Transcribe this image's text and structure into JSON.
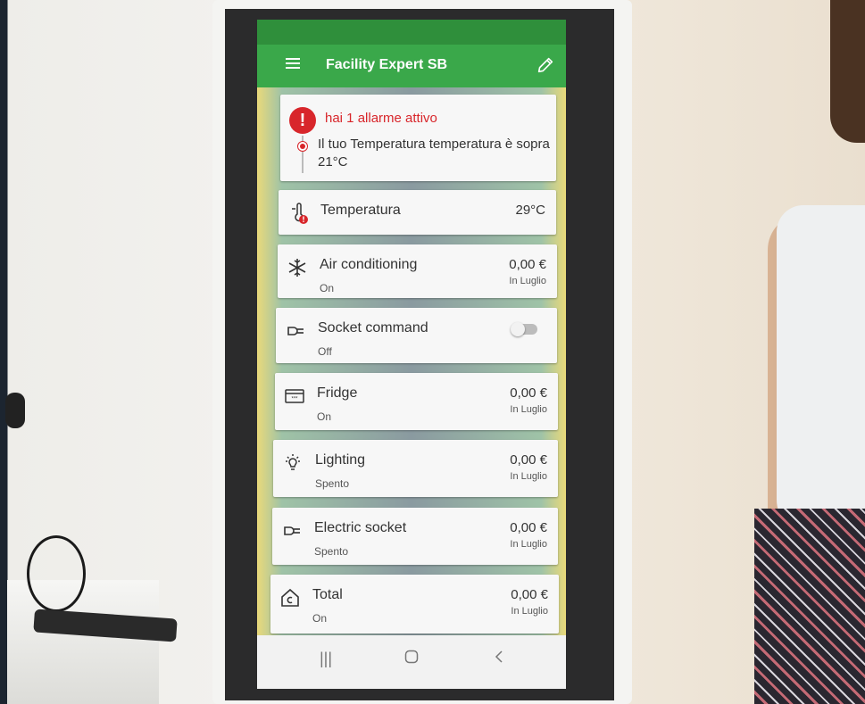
{
  "app": {
    "title": "Facility Expert SB"
  },
  "alarm": {
    "title": "hai 1 allarme attivo",
    "message": "Il tuo Temperatura temperatura è sopra 21°C"
  },
  "devices": [
    {
      "name": "Temperatura",
      "value": "29°C",
      "icon": "thermometer-alert-icon"
    },
    {
      "name": "Air conditioning",
      "status": "On",
      "value": "0,00 €",
      "period": "In Luglio",
      "icon": "snowflake-icon"
    },
    {
      "name": "Socket command",
      "status": "Off",
      "icon": "plug-icon",
      "toggle": false
    },
    {
      "name": "Fridge",
      "status": "On",
      "value": "0,00 €",
      "period": "In Luglio",
      "icon": "fridge-icon"
    },
    {
      "name": "Lighting",
      "status": "Spento",
      "value": "0,00 €",
      "period": "In Luglio",
      "icon": "light-bulb-icon"
    },
    {
      "name": "Electric socket",
      "status": "Spento",
      "value": "0,00 €",
      "period": "In Luglio",
      "icon": "plug-icon"
    },
    {
      "name": "Total",
      "status": "On",
      "value": "0,00 €",
      "period": "In Luglio",
      "icon": "home-icon"
    }
  ],
  "colors": {
    "app_bar": "#3aa84a",
    "alarm": "#d8262b"
  }
}
